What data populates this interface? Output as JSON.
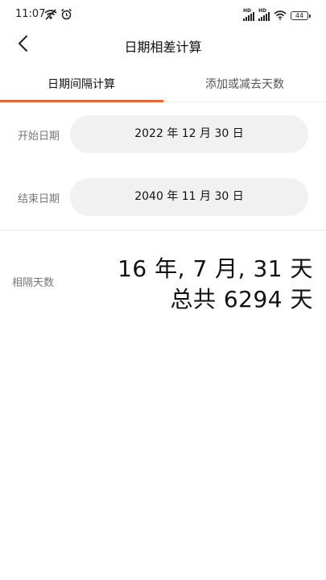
{
  "status_bar": {
    "time": "11:07",
    "battery": "44",
    "left_icons": [
      "wifi-off-icon",
      "alarm-icon"
    ],
    "right_icons": [
      "signal-hd-icon",
      "signal-hd-icon",
      "wifi-icon",
      "battery-icon"
    ],
    "signal_label": "HD"
  },
  "nav": {
    "title": "日期相差计算",
    "back_icon": "chevron-left-icon"
  },
  "tabs": [
    {
      "label": "日期间隔计算",
      "active": true
    },
    {
      "label": "添加或减去天数",
      "active": false
    }
  ],
  "colors": {
    "accent": "#e8663a",
    "pill_bg": "#f1f1f1",
    "label_text": "#777777"
  },
  "form": {
    "start_label": "开始日期",
    "start_value": "2022 年 12 月 30 日",
    "end_label": "结束日期",
    "end_value": "2040 年 11 月 30 日"
  },
  "result": {
    "label": "相隔天数",
    "line1": "16 年, 7 月, 31 天",
    "line2": "总共 6294 天"
  }
}
